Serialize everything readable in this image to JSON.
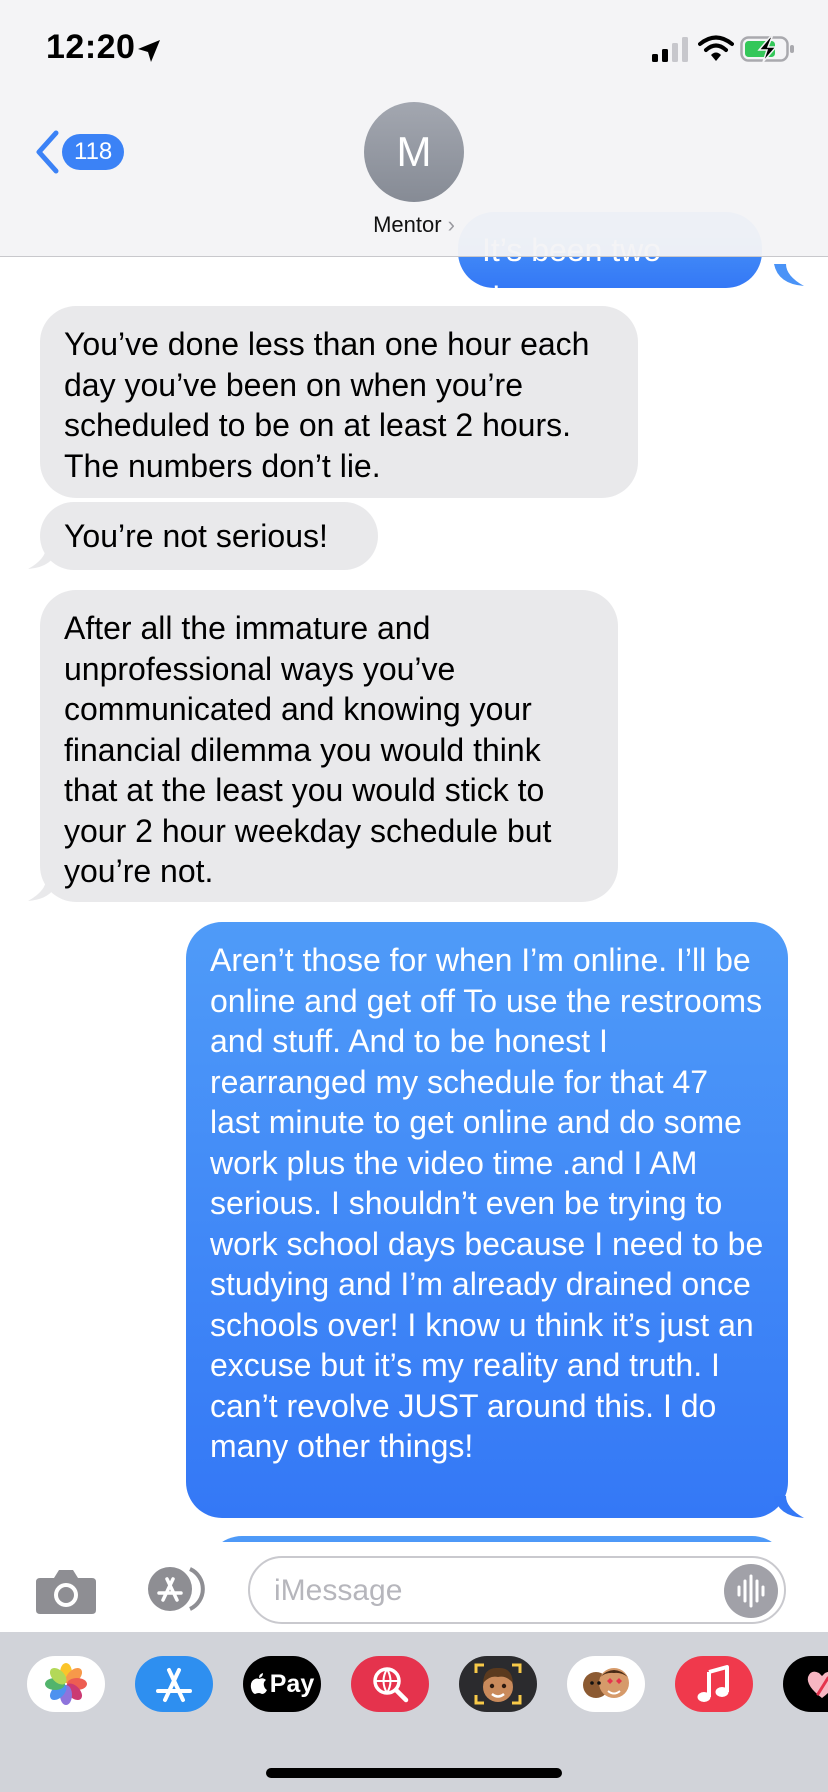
{
  "status_bar": {
    "time": "12:20",
    "icons": [
      "location-arrow-icon",
      "cellular-signal-icon",
      "wifi-icon",
      "battery-charging-icon"
    ]
  },
  "header": {
    "back_badge": "118",
    "avatar_initial": "M",
    "contact_name": "Mentor",
    "chevron": "›"
  },
  "messages": [
    {
      "direction": "sent",
      "text": "It’s been two days."
    },
    {
      "direction": "received",
      "text": "You’ve done less than one hour each day you’ve been on when you’re scheduled to be on at least 2 hours. The numbers don’t lie."
    },
    {
      "direction": "received",
      "text": "You’re not serious!"
    },
    {
      "direction": "received",
      "text": "After all the immature and unprofessional ways you’ve communicated and knowing your financial dilemma you would think that at the least you would stick to your 2 hour weekday schedule but you’re not."
    },
    {
      "direction": "sent",
      "text": "Aren’t those for when I’m online. I’ll be online and get off To use the restrooms and stuff. And to be honest I rearranged my schedule for that 47 last minute to get online and do some work plus the video time .and I AM serious. I shouldn’t even be trying to work school days because I need to be studying and I’m already drained once schools over! I know u think it’s just an excuse but it’s my reality and truth. I can’t revolve JUST around this. I do many other things!"
    }
  ],
  "input": {
    "placeholder": "iMessage"
  },
  "app_drawer": [
    {
      "name": "photos-app-icon",
      "label": ""
    },
    {
      "name": "app-store-icon",
      "label": ""
    },
    {
      "name": "apple-pay-icon",
      "label": "Pay"
    },
    {
      "name": "web-search-icon",
      "label": ""
    },
    {
      "name": "memoji-icon",
      "label": ""
    },
    {
      "name": "animoji-stickers-icon",
      "label": ""
    },
    {
      "name": "music-icon",
      "label": ""
    },
    {
      "name": "digital-touch-icon",
      "label": ""
    }
  ],
  "colors": {
    "sent_bubble": "#3478f6",
    "received_bubble": "#e9e9eb",
    "accent": "#3b82f6",
    "drawer_background": "#d1d3d9"
  }
}
